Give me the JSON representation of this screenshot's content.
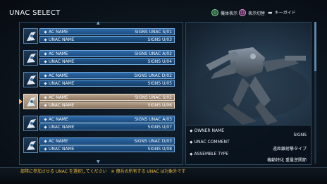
{
  "header": {
    "title": "UNAC SELECT",
    "guide": [
      {
        "icon": "triangle-button-icon",
        "label": "機体表示"
      },
      {
        "icon": "square-button-icon",
        "label": "表示切替"
      },
      {
        "icon": "select-button-icon",
        "label": "キーガイド"
      }
    ]
  },
  "list": {
    "rows": [
      {
        "ac_label": "AC NAME",
        "ac_value": "SIGNS UNAC S/01",
        "unac_label": "UNAC NAME",
        "unac_value": "SIGNS U/03",
        "selected": false
      },
      {
        "ac_label": "AC NAME",
        "ac_value": "SIGNS UNAC A/02",
        "unac_label": "UNAC NAME",
        "unac_value": "SIGNS U/04",
        "selected": false
      },
      {
        "ac_label": "AC NAME",
        "ac_value": "SIGNS UNAC D/02",
        "unac_label": "UNAC NAME",
        "unac_value": "SIGNS U/05",
        "selected": false
      },
      {
        "ac_label": "AC NAME",
        "ac_value": "SIGNS UNAC S/02",
        "unac_label": "UNAC NAME",
        "unac_value": "SIGNS U/06",
        "selected": true
      },
      {
        "ac_label": "AC NAME",
        "ac_value": "SIGNS UNAC A/03",
        "unac_label": "UNAC NAME",
        "unac_value": "SIGNS U/07",
        "selected": false
      },
      {
        "ac_label": "AC NAME",
        "ac_value": "SIGNS UNAC D/03",
        "unac_label": "UNAC NAME",
        "unac_value": "SIGNS U/08",
        "selected": false
      }
    ]
  },
  "details": {
    "owner_label": "OWNER NAME",
    "owner_value": "SIGNS",
    "comment_label": "UNAC COMMENT",
    "comment_value": "遠距離射撃タイプ",
    "assemble_label": "ASSEMBLE TYPE",
    "assemble_value": "機動特化 重量逆関節"
  },
  "footer": {
    "message": "部隊に参加させる UNAC を選択してください　※ 僚兵の所有する UNAC は対象外です"
  },
  "colors": {
    "accent_blue": "#2d6aa8",
    "selected_row": "#b9a48e",
    "footer_text": "#e5b840"
  }
}
